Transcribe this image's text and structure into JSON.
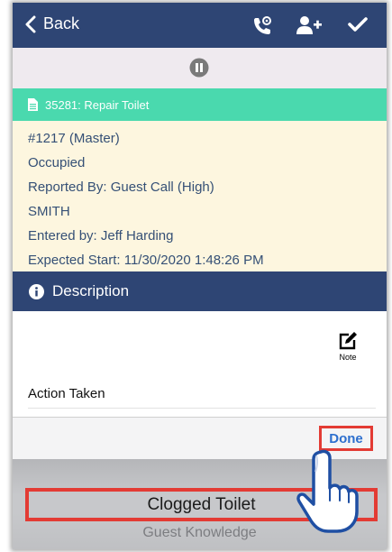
{
  "navbar": {
    "back_label": "Back",
    "icons": [
      "phone-settings-icon",
      "add-user-icon",
      "checkmark-icon"
    ]
  },
  "subbar": {
    "icon": "pause-icon"
  },
  "task": {
    "icon": "document-icon",
    "title": "35281: Repair Toilet"
  },
  "details": {
    "lines": [
      "#1217 (Master)",
      "Occupied",
      "Reported By: Guest Call  (High)",
      "SMITH",
      "Entered by: Jeff Harding",
      "Expected Start: 11/30/2020 1:48:26 PM"
    ]
  },
  "description": {
    "icon": "info-icon",
    "title": "Description"
  },
  "note": {
    "icon": "edit-icon",
    "label": "Note"
  },
  "action": {
    "label": "Action Taken"
  },
  "keyboard_bar": {
    "done_label": "Done"
  },
  "picker": {
    "prev_option": "",
    "selected_option": "Clogged Toilet",
    "next_option": "Guest Knowledge"
  },
  "colors": {
    "navbar": "#2e4574",
    "task_bar": "#4ad9ae",
    "info_panel": "#fdf6df",
    "info_text": "#355076",
    "highlight": "#e33b34",
    "done_text": "#2d6fce"
  }
}
